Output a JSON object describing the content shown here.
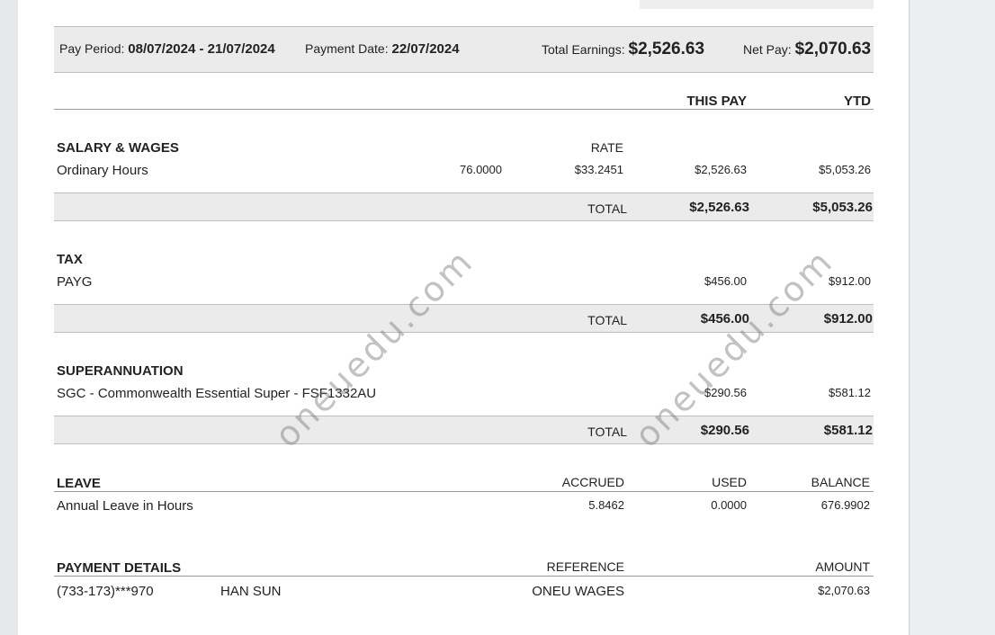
{
  "header": {
    "pay_period_label": "Pay Period:",
    "pay_period_value": "08/07/2024 - 21/07/2024",
    "payment_date_label": "Payment Date:",
    "payment_date_value": "22/07/2024",
    "total_earnings_label": "Total Earnings:",
    "total_earnings_value": "$2,526.63",
    "net_pay_label": "Net Pay:",
    "net_pay_value": "$2,070.63"
  },
  "columns": {
    "this_pay": "THIS PAY",
    "ytd": "YTD"
  },
  "salary": {
    "heading": "SALARY & WAGES",
    "rate_label": "RATE",
    "item": "Ordinary Hours",
    "hours": "76.0000",
    "rate": "$33.2451",
    "this_pay": "$2,526.63",
    "ytd": "$5,053.26",
    "total_label": "TOTAL",
    "total_this_pay": "$2,526.63",
    "total_ytd": "$5,053.26"
  },
  "tax": {
    "heading": "TAX",
    "item": "PAYG",
    "this_pay": "$456.00",
    "ytd": "$912.00",
    "total_label": "TOTAL",
    "total_this_pay": "$456.00",
    "total_ytd": "$912.00"
  },
  "super": {
    "heading": "SUPERANNUATION",
    "item": "SGC - Commonwealth Essential Super - FSF1332AU",
    "this_pay": "$290.56",
    "ytd": "$581.12",
    "total_label": "TOTAL",
    "total_this_pay": "$290.56",
    "total_ytd": "$581.12"
  },
  "leave": {
    "heading": "LEAVE",
    "accrued_label": "ACCRUED",
    "used_label": "USED",
    "balance_label": "BALANCE",
    "item": "Annual Leave in Hours",
    "accrued": "5.8462",
    "used": "0.0000",
    "balance": "676.9902"
  },
  "payment": {
    "heading": "PAYMENT DETAILS",
    "reference_label": "REFERENCE",
    "amount_label": "AMOUNT",
    "account": "(733-173)***970",
    "name": "HAN SUN",
    "reference": "ONEU WAGES",
    "amount": "$2,070.63"
  },
  "watermark": {
    "text": "oneuedu.com"
  }
}
